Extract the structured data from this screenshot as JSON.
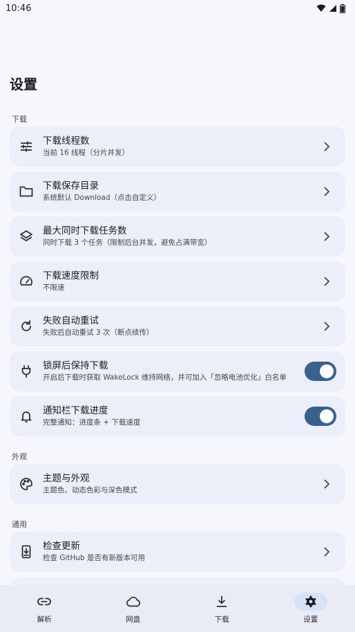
{
  "status_bar": {
    "time": "10:46"
  },
  "page": {
    "title": "设置"
  },
  "sections": {
    "download": "下载",
    "appearance": "外观",
    "general": "通用"
  },
  "items": {
    "threads": {
      "title": "下载线程数",
      "subtitle": "当前 16 线程（分片并发）",
      "icon": "tune-icon"
    },
    "dir": {
      "title": "下载保存目录",
      "subtitle": "系统默认 Download（点击自定义）",
      "icon": "folder-icon"
    },
    "max_tasks": {
      "title": "最大同时下载任务数",
      "subtitle": "同时下载 3 个任务（限制后台并发，避免占满带宽）",
      "icon": "layers-icon"
    },
    "speed": {
      "title": "下载速度限制",
      "subtitle": "不限速",
      "icon": "speedometer-icon"
    },
    "retry": {
      "title": "失败自动重试",
      "subtitle": "失败后自动重试 3 次（断点续传）",
      "icon": "refresh-icon"
    },
    "wakelock": {
      "title": "锁屏后保持下载",
      "subtitle": "开启后下载时获取 WakeLock 维持网络，并可加入「忽略电池优化」白名单",
      "icon": "plug-icon",
      "enabled": true
    },
    "notify": {
      "title": "通知栏下载进度",
      "subtitle": "完整通知：进度条 + 下载速度",
      "icon": "bell-icon",
      "enabled": true
    },
    "theme": {
      "title": "主题与外观",
      "subtitle": "主题色、动态色彩与深色模式",
      "icon": "palette-icon"
    },
    "update": {
      "title": "检查更新",
      "subtitle": "检查 GitHub 是否有新版本可用",
      "icon": "system-update-icon"
    }
  },
  "nav": [
    {
      "label": "解析",
      "icon": "link-icon",
      "active": false
    },
    {
      "label": "网盘",
      "icon": "cloud-icon",
      "active": false
    },
    {
      "label": "下载",
      "icon": "download-icon",
      "active": false
    },
    {
      "label": "设置",
      "icon": "settings-gear-icon",
      "active": true
    }
  ],
  "colors": {
    "accent": "#38618f",
    "card": "#eceff9",
    "background": "#f6f7fd",
    "nav_active": "#d5e2f8"
  }
}
